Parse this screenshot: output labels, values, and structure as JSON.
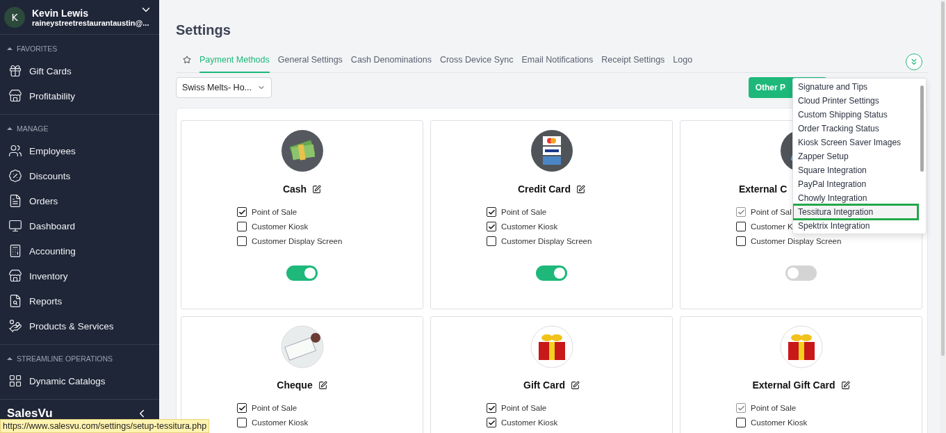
{
  "sidebar": {
    "user": {
      "initial": "K",
      "name": "Kevin Lewis",
      "email": "raineystreetrestaurantaustin@..."
    },
    "sections": [
      {
        "title": "FAVORITES",
        "items": [
          {
            "label": "Gift Cards"
          },
          {
            "label": "Profitability"
          }
        ]
      },
      {
        "title": "MANAGE",
        "items": [
          {
            "label": "Employees"
          },
          {
            "label": "Discounts"
          },
          {
            "label": "Orders"
          },
          {
            "label": "Dashboard"
          },
          {
            "label": "Accounting"
          },
          {
            "label": "Inventory"
          },
          {
            "label": "Reports"
          },
          {
            "label": "Products & Services"
          }
        ]
      },
      {
        "title": "STREAMLINE OPERATIONS",
        "items": [
          {
            "label": "Dynamic Catalogs"
          }
        ]
      }
    ],
    "logo": "SalesVu"
  },
  "page_title": "Settings",
  "tabs": [
    {
      "label": "Payment Methods",
      "selected": true
    },
    {
      "label": "General Settings",
      "selected": false
    },
    {
      "label": "Cash Denominations",
      "selected": false
    },
    {
      "label": "Cross Device Sync",
      "selected": false
    },
    {
      "label": "Email Notifications",
      "selected": false
    },
    {
      "label": "Receipt Settings",
      "selected": false
    },
    {
      "label": "Logo",
      "selected": false
    }
  ],
  "location_select": {
    "value": "Swiss Melts- Ho..."
  },
  "other_button": "Other P",
  "dropdown": [
    {
      "label": "Signature and Tips",
      "selected": false
    },
    {
      "label": "Cloud Printer Settings",
      "selected": false
    },
    {
      "label": "Custom Shipping Status",
      "selected": false
    },
    {
      "label": "Order Tracking Status",
      "selected": false
    },
    {
      "label": "Kiosk Screen Saver Images",
      "selected": false
    },
    {
      "label": "Zapper Setup",
      "selected": false
    },
    {
      "label": "Square Integration",
      "selected": false
    },
    {
      "label": "PayPal Integration",
      "selected": false
    },
    {
      "label": "Chowly Integration",
      "selected": false
    },
    {
      "label": "Tessitura Integration",
      "selected": true
    },
    {
      "label": "Spektrix Integration",
      "selected": false
    }
  ],
  "cards": [
    {
      "title": "Cash",
      "kind": "cash",
      "options": [
        {
          "label": "Point of Sale",
          "checked": true,
          "disabled": false
        },
        {
          "label": "Customer Kiosk",
          "checked": false,
          "disabled": false
        },
        {
          "label": "Customer Display Screen",
          "checked": false,
          "disabled": false
        }
      ],
      "enabled": true
    },
    {
      "title": "Credit Card",
      "kind": "credit",
      "options": [
        {
          "label": "Point of Sale",
          "checked": true,
          "disabled": false
        },
        {
          "label": "Customer Kiosk",
          "checked": true,
          "disabled": false
        },
        {
          "label": "Customer Display Screen",
          "checked": false,
          "disabled": false
        }
      ],
      "enabled": true
    },
    {
      "title": "External C",
      "kind": "reader",
      "options": [
        {
          "label": "Point of Sal",
          "checked": true,
          "disabled": true
        },
        {
          "label": "Customer K",
          "checked": false,
          "disabled": false
        },
        {
          "label": "Customer Display Screen",
          "checked": false,
          "disabled": false
        }
      ],
      "enabled": false
    },
    {
      "title": "Cheque",
      "kind": "cheque",
      "options": [
        {
          "label": "Point of Sale",
          "checked": true,
          "disabled": false
        },
        {
          "label": "Customer Kiosk",
          "checked": false,
          "disabled": false
        }
      ]
    },
    {
      "title": "Gift Card",
      "kind": "gift",
      "options": [
        {
          "label": "Point of Sale",
          "checked": true,
          "disabled": false
        },
        {
          "label": "Customer Kiosk",
          "checked": true,
          "disabled": false
        }
      ]
    },
    {
      "title": "External Gift Card",
      "kind": "gift",
      "options": [
        {
          "label": "Point of Sale",
          "checked": true,
          "disabled": true
        },
        {
          "label": "Customer Kiosk",
          "checked": false,
          "disabled": false
        }
      ]
    }
  ],
  "status_url": "https://www.salesvu.com/settings/setup-tessitura.php"
}
